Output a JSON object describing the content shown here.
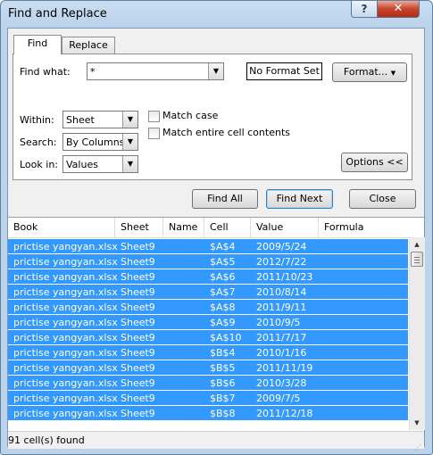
{
  "window": {
    "title": "Find and Replace",
    "help": "?",
    "close": "✕"
  },
  "tabs": [
    {
      "label": "Find"
    },
    {
      "label": "Replace"
    }
  ],
  "find": {
    "find_what_label": "Find what:",
    "find_what_value": "*",
    "format_status": "No Format Set",
    "format_button": "Format...",
    "within_label": "Within:",
    "within_value": "Sheet",
    "search_label": "Search:",
    "search_value": "By Columns",
    "lookin_label": "Look in:",
    "lookin_value": "Values",
    "match_case": "Match case",
    "match_entire": "Match entire cell contents",
    "options_button": "Options <<"
  },
  "actions": {
    "find_all": "Find All",
    "find_next": "Find Next",
    "close": "Close"
  },
  "results": {
    "columns": [
      "Book",
      "Sheet",
      "Name",
      "Cell",
      "Value",
      "Formula"
    ],
    "rows": [
      {
        "book": "prictise yangyan.xlsx",
        "sheet": "Sheet9",
        "name": "",
        "cell": "$A$4",
        "value": "2009/5/24",
        "formula": ""
      },
      {
        "book": "prictise yangyan.xlsx",
        "sheet": "Sheet9",
        "name": "",
        "cell": "$A$5",
        "value": "2012/7/22",
        "formula": ""
      },
      {
        "book": "prictise yangyan.xlsx",
        "sheet": "Sheet9",
        "name": "",
        "cell": "$A$6",
        "value": "2011/10/23",
        "formula": ""
      },
      {
        "book": "prictise yangyan.xlsx",
        "sheet": "Sheet9",
        "name": "",
        "cell": "$A$7",
        "value": "2010/8/14",
        "formula": ""
      },
      {
        "book": "prictise yangyan.xlsx",
        "sheet": "Sheet9",
        "name": "",
        "cell": "$A$8",
        "value": "2011/9/11",
        "formula": ""
      },
      {
        "book": "prictise yangyan.xlsx",
        "sheet": "Sheet9",
        "name": "",
        "cell": "$A$9",
        "value": "2010/9/5",
        "formula": ""
      },
      {
        "book": "prictise yangyan.xlsx",
        "sheet": "Sheet9",
        "name": "",
        "cell": "$A$10",
        "value": "2011/7/17",
        "formula": ""
      },
      {
        "book": "prictise yangyan.xlsx",
        "sheet": "Sheet9",
        "name": "",
        "cell": "$B$4",
        "value": "2010/1/16",
        "formula": ""
      },
      {
        "book": "prictise yangyan.xlsx",
        "sheet": "Sheet9",
        "name": "",
        "cell": "$B$5",
        "value": "2011/11/19",
        "formula": ""
      },
      {
        "book": "prictise yangyan.xlsx",
        "sheet": "Sheet9",
        "name": "",
        "cell": "$B$6",
        "value": "2010/3/28",
        "formula": ""
      },
      {
        "book": "prictise yangyan.xlsx",
        "sheet": "Sheet9",
        "name": "",
        "cell": "$B$7",
        "value": "2009/7/5",
        "formula": ""
      },
      {
        "book": "prictise yangyan.xlsx",
        "sheet": "Sheet9",
        "name": "",
        "cell": "$B$8",
        "value": "2011/12/18",
        "formula": ""
      }
    ],
    "status": "91 cell(s) found"
  },
  "colors": {
    "selection": "#3399ff",
    "close_button": "#c7432b"
  }
}
